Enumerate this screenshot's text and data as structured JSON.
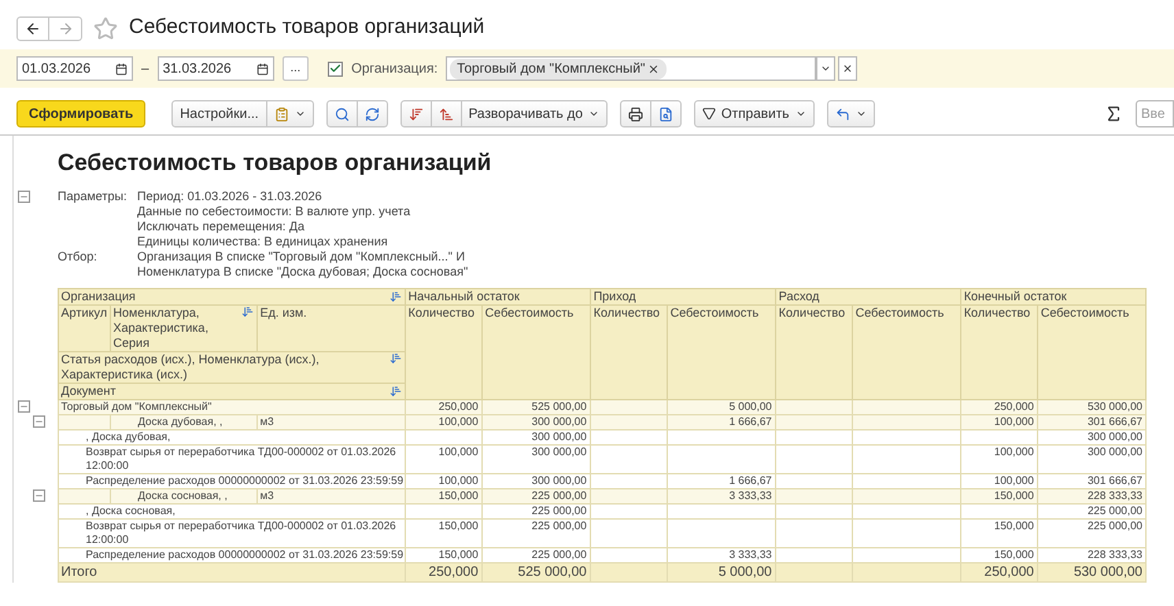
{
  "window": {
    "title": "Себестоимость товаров организаций",
    "favorite": false
  },
  "filter": {
    "date_from": "01.03.2026",
    "date_separator": "–",
    "date_to": "31.03.2026",
    "period_button": "...",
    "organization_enabled": true,
    "organization_label": "Организация:",
    "organization_tag": "Торговый дом \"Комплексный\""
  },
  "toolbar": {
    "generate": "Сформировать",
    "settings": "Настройки...",
    "expand": "Разворачивать до",
    "send": "Отправить",
    "search_placeholder": "Вве"
  },
  "report": {
    "title": "Себестоимость товаров организаций",
    "expanded": true,
    "params_label": "Параметры:",
    "params": [
      "Период: 01.03.2026 - 31.03.2026",
      "Данные по себестоимости: В валюте упр. учета",
      "Исключать перемещения: Да",
      "Единицы количества: В единицах хранения"
    ],
    "filter_label": "Отбор:",
    "filters": [
      "Организация В списке \"Торговый дом \"Комплексный...\" И",
      "Номенклатура В списке \"Доска дубовая; Доска сосновая\""
    ]
  },
  "table": {
    "header": {
      "organization": "Организация",
      "article": "Артикул",
      "nomenclature": "Номенклатура, Характеристика, Серия",
      "unit": "Ед. изм.",
      "expense_item": "Статья расходов (исх.), Номенклатура (исх.), Характеристика (исх.)",
      "document": "Документ",
      "groups": [
        {
          "title": "Начальный остаток",
          "columns": [
            "Количество",
            "Себестоимость"
          ]
        },
        {
          "title": "Приход",
          "columns": [
            "Количество",
            "Себестоимость"
          ]
        },
        {
          "title": "Расход",
          "columns": [
            "Количество",
            "Себестоимость"
          ]
        },
        {
          "title": "Конечный остаток",
          "columns": [
            "Количество",
            "Себестоимость"
          ]
        }
      ]
    },
    "rows": [
      {
        "kind": "group",
        "expanded": true,
        "label": "Торговый дом \"Комплексный\"",
        "values": {
          "opening_qty": "250,000",
          "opening_cost": "525 000,00",
          "in_cost": "5 000,00",
          "closing_qty": "250,000",
          "closing_cost": "530 000,00"
        }
      },
      {
        "kind": "item",
        "expanded": true,
        "name": "Доска дубовая, ,",
        "unit": "м3",
        "values": {
          "opening_qty": "100,000",
          "opening_cost": "300 000,00",
          "in_cost": "1 666,67",
          "closing_qty": "100,000",
          "closing_cost": "301 666,67"
        }
      },
      {
        "kind": "detail",
        "label": ", Доска дубовая,",
        "values": {
          "opening_cost": "300 000,00",
          "closing_cost": "300 000,00"
        }
      },
      {
        "kind": "detail",
        "label": "Возврат сырья от переработчика ТД00-000002 от 01.03.2026 12:00:00",
        "values": {
          "opening_qty": "100,000",
          "opening_cost": "300 000,00",
          "closing_qty": "100,000",
          "closing_cost": "300 000,00"
        }
      },
      {
        "kind": "detail",
        "label": "Распределение расходов 00000000002 от 31.03.2026 23:59:59",
        "values": {
          "opening_qty": "100,000",
          "opening_cost": "300 000,00",
          "in_cost": "1 666,67",
          "closing_qty": "100,000",
          "closing_cost": "301 666,67"
        }
      },
      {
        "kind": "item",
        "expanded": true,
        "name": "Доска сосновая, ,",
        "unit": "м3",
        "values": {
          "opening_qty": "150,000",
          "opening_cost": "225 000,00",
          "in_cost": "3 333,33",
          "closing_qty": "150,000",
          "closing_cost": "228 333,33"
        }
      },
      {
        "kind": "detail",
        "label": ", Доска сосновая,",
        "values": {
          "opening_cost": "225 000,00",
          "closing_cost": "225 000,00"
        }
      },
      {
        "kind": "detail",
        "label": "Возврат сырья от переработчика ТД00-000002 от 01.03.2026 12:00:00",
        "values": {
          "opening_qty": "150,000",
          "opening_cost": "225 000,00",
          "closing_qty": "150,000",
          "closing_cost": "225 000,00"
        }
      },
      {
        "kind": "detail",
        "label": "Распределение расходов 00000000002 от 31.03.2026 23:59:59",
        "values": {
          "opening_qty": "150,000",
          "opening_cost": "225 000,00",
          "in_cost": "3 333,33",
          "closing_qty": "150,000",
          "closing_cost": "228 333,33"
        }
      }
    ],
    "total": {
      "label": "Итого",
      "values": {
        "opening_qty": "250,000",
        "opening_cost": "525 000,00",
        "in_cost": "5 000,00",
        "closing_qty": "250,000",
        "closing_cost": "530 000,00"
      }
    }
  }
}
